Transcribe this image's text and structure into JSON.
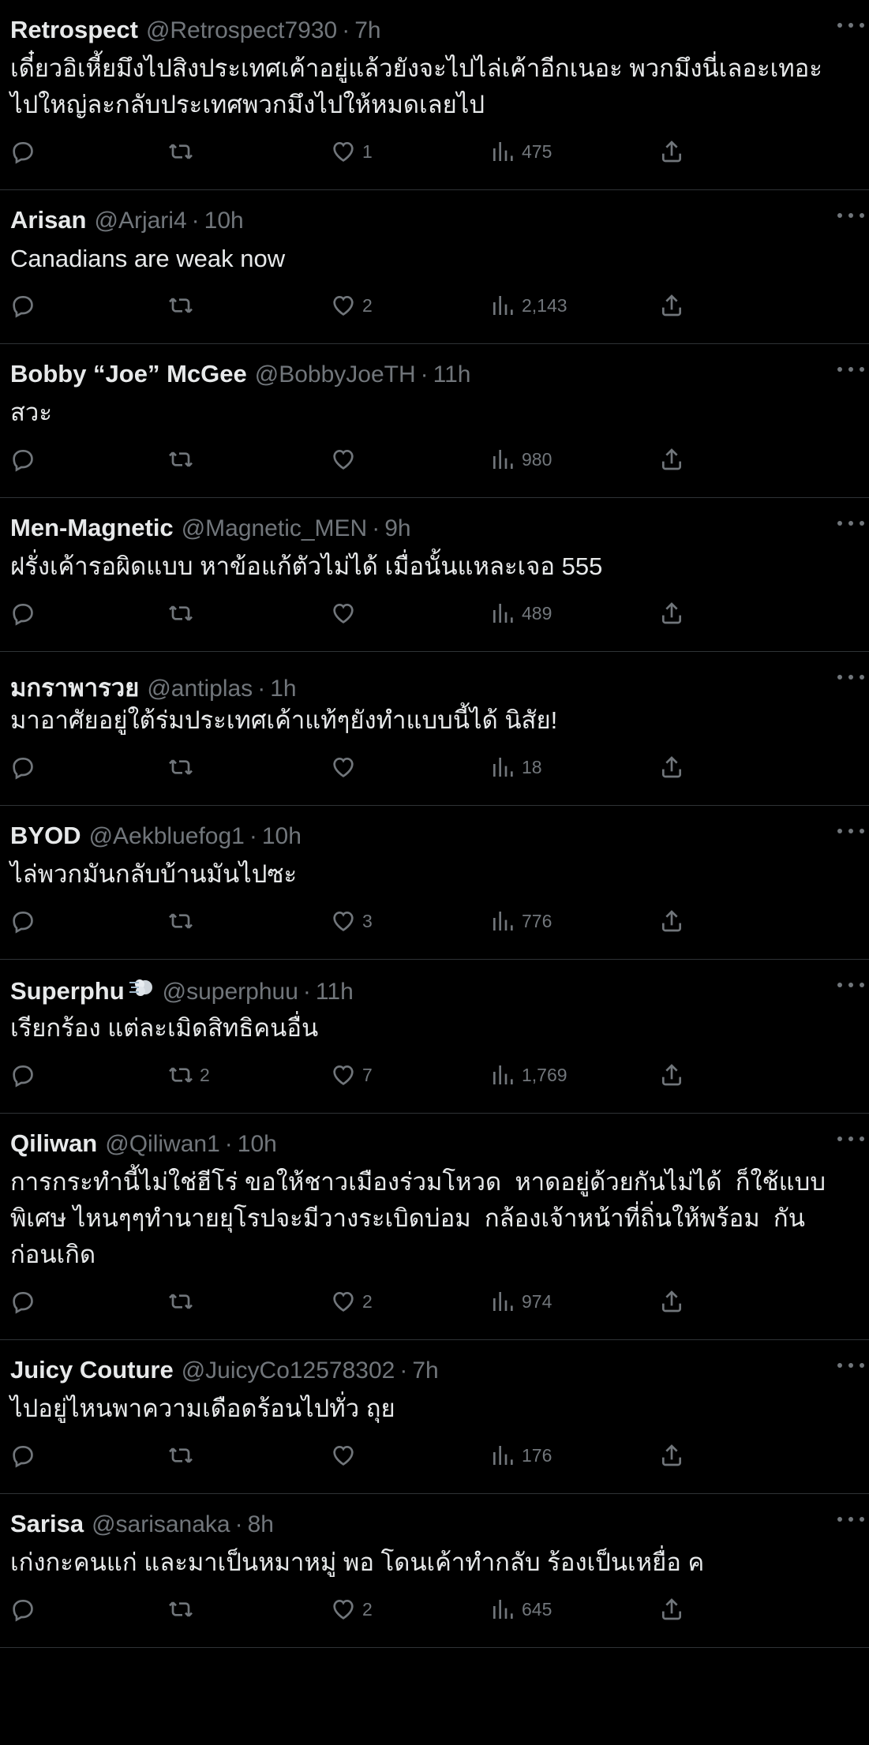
{
  "tweets": [
    {
      "name": "Retrospect",
      "handle": "@Retrospect7930",
      "time": "7h",
      "text": "เดี๋ยวอิเหี้ยมึงไปสิงประเทศเค้าอยู่แล้วยังจะไปไล่เค้าอีกเนอะ พวกมึงนี่เลอะเทอะ\nไปใหญ่ละกลับประเทศพวกมึงไปให้หมดเลยไป",
      "replies": "",
      "retweets": "",
      "likes": "1",
      "views": "475"
    },
    {
      "name": "Arisan",
      "handle": "@Arjari4",
      "time": "10h",
      "text": "Canadians are weak now",
      "replies": "",
      "retweets": "",
      "likes": "2",
      "views": "2,143"
    },
    {
      "name": "Bobby “Joe” McGee",
      "handle": "@BobbyJoeTH",
      "time": "11h",
      "text": "สวะ",
      "replies": "",
      "retweets": "",
      "likes": "",
      "views": "980"
    },
    {
      "name": "Men-Magnetic",
      "handle": "@Magnetic_MEN",
      "time": "9h",
      "text": "ฝรั่งเค้ารอผิดแบบ หาข้อแก้ตัวไม่ได้ เมื่อนั้นแหละเจอ 555",
      "replies": "",
      "retweets": "",
      "likes": "",
      "views": "489"
    },
    {
      "name": "มกราพารวย",
      "handle": "@antiplas",
      "time": "1h",
      "text": "มาอาศัยอยู่ใต้ร่มประเทศเค้าแท้ๆยังทำแบบนี้ได้ นิสัย!",
      "replies": "",
      "retweets": "",
      "likes": "",
      "views": "18"
    },
    {
      "name": "BYOD",
      "handle": "@Aekbluefog1",
      "time": "10h",
      "text": "ไล่พวกมันกลับบ้านมันไปซะ",
      "replies": "",
      "retweets": "",
      "likes": "3",
      "views": "776"
    },
    {
      "name": "Superphu",
      "handle": "@superphuu",
      "time": "11h",
      "emoji": "dash-emoji",
      "text": "เรียกร้อง แต่ละเมิดสิทธิคนอื่น",
      "replies": "",
      "retweets": "2",
      "likes": "7",
      "views": "1,769"
    },
    {
      "name": "Qiliwan",
      "handle": "@Qiliwan1",
      "time": "10h",
      "text": "การกระทำนี้ไม่ใช่ฮีโร่ ขอให้ชาวเมืองร่วมโหวด  หาดอยู่ด้วยกันไม่ได้  ก็ใช้แบบ\nพิเศษ ไหนๆๆทำนายยุโรปจะมีวางระเบิดบ่อม  กล้องเจ้าหน้าที่ถิ่นให้พร้อม  กัน\nก่อนเกิด",
      "replies": "",
      "retweets": "",
      "likes": "2",
      "views": "974"
    },
    {
      "name": "Juicy Couture",
      "handle": "@JuicyCo12578302",
      "time": "7h",
      "text": "ไปอยู่ไหนพาความเดือดร้อนไปทั่ว ถุย",
      "replies": "",
      "retweets": "",
      "likes": "",
      "views": "176"
    },
    {
      "name": "Sarisa",
      "handle": "@sarisanaka",
      "time": "8h",
      "text": "เก่งกะคนแก่ และมาเป็นหมาหมู่ พอ โดนเค้าทำกลับ ร้องเป็นเหยื่อ ค",
      "replies": "",
      "retweets": "",
      "likes": "2",
      "views": "645"
    }
  ]
}
